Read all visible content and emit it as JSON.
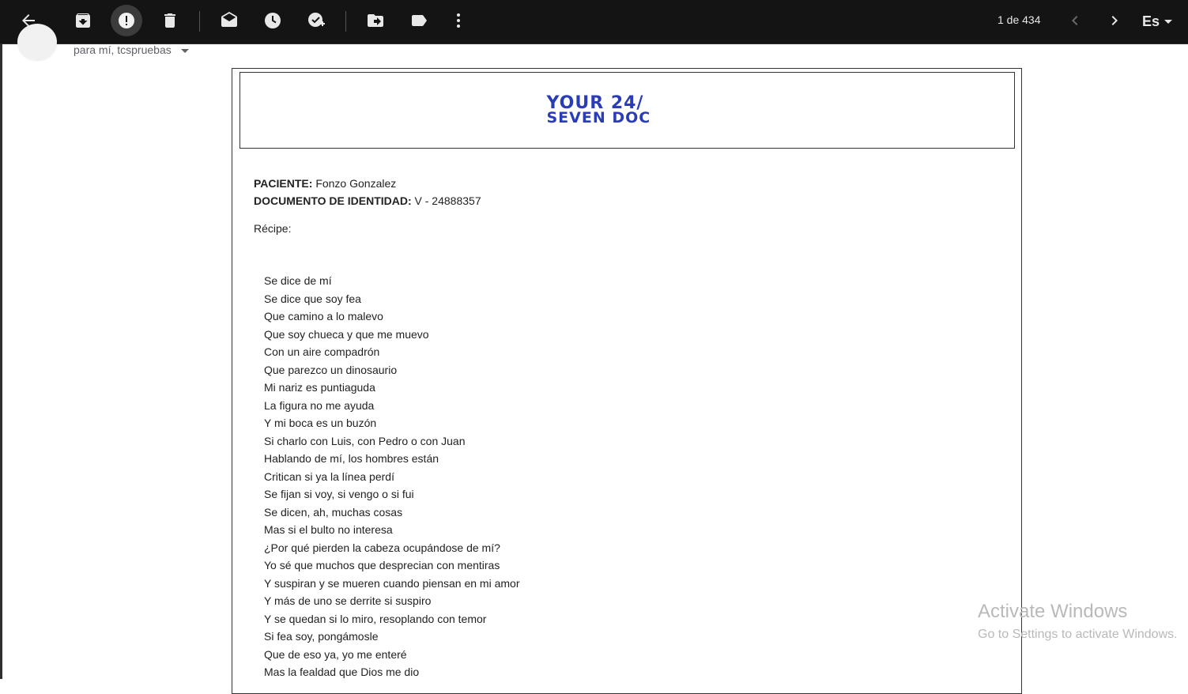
{
  "toolbar": {
    "buttons": [
      {
        "name": "back",
        "icon": "arrow-back-icon"
      },
      {
        "name": "archive",
        "icon": "archive-icon"
      },
      {
        "name": "report-spam",
        "icon": "report-icon",
        "active": true
      },
      {
        "name": "delete",
        "icon": "trash-icon"
      },
      {
        "name": "mark-unread",
        "icon": "mail-open-icon"
      },
      {
        "name": "snooze",
        "icon": "clock-icon"
      },
      {
        "name": "add-to-tasks",
        "icon": "task-add-icon"
      },
      {
        "name": "move-to",
        "icon": "move-to-icon"
      },
      {
        "name": "labels",
        "icon": "label-icon"
      },
      {
        "name": "more",
        "icon": "more-vert-icon"
      }
    ],
    "pager_text": "1 de 434",
    "language_label": "Es",
    "colors": {
      "background": "#141414",
      "icon": "#e8e8e8"
    }
  },
  "header": {
    "recipients": "para mí, tcspruebas"
  },
  "email": {
    "logo": {
      "line1": "YOUR 24/",
      "line2": "SEVEN DOC",
      "color": "#2b3cb7"
    },
    "patient_label": "PACIENTE:",
    "patient_value": "Fonzo Gonzalez",
    "id_label": "DOCUMENTO DE IDENTIDAD:",
    "id_value": "V - 24888357",
    "recipe_label": "Récipe:",
    "poem_lines": [
      "Se dice de mí",
      "Se dice que soy fea",
      "Que camino a lo malevo",
      "Que soy chueca y que me muevo",
      "Con un aire compadrón",
      "Que parezco un dinosaurio",
      "Mi nariz es puntiaguda",
      "La figura no me ayuda",
      "Y mi boca es un buzón",
      "Si charlo con Luis, con Pedro o con Juan",
      "Hablando de mí, los hombres están",
      "Critican si ya la línea perdí",
      "Se fijan si voy, si vengo o si fui",
      "Se dicen, ah, muchas cosas",
      "Mas si el bulto no interesa",
      "¿Por qué pierden la cabeza ocupándose de mí?",
      "Yo sé que muchos que desprecian con mentiras",
      "Y suspiran y se mueren cuando piensan en mi amor",
      "Y más de uno se derrite si suspiro",
      "Y se quedan si lo miro, resoplando con temor",
      "Si fea soy, pongámosle",
      "Que de eso ya, yo me enteré",
      "Mas la fealdad que Dios me dio"
    ]
  },
  "watermark": {
    "title": "Activate Windows",
    "subtitle": "Go to Settings to activate Windows."
  }
}
